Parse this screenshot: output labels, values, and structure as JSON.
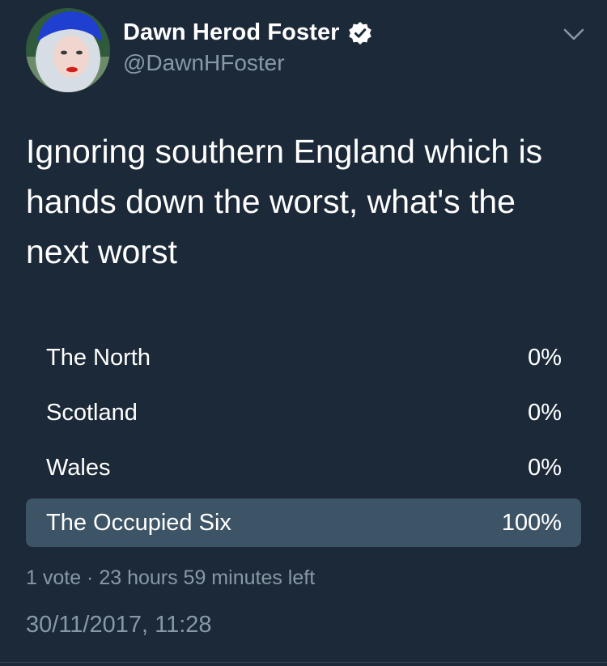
{
  "author": {
    "display_name": "Dawn Herod Foster",
    "handle": "@DawnHFoster",
    "verified": true,
    "avatar_icon": "profile-photo"
  },
  "tweet": {
    "text": "Ignoring southern England which is hands down the worst, what's the next worst"
  },
  "poll": {
    "options": [
      {
        "label": "The North",
        "percent_text": "0%",
        "percent": 0
      },
      {
        "label": "Scotland",
        "percent_text": "0%",
        "percent": 0
      },
      {
        "label": "Wales",
        "percent_text": "0%",
        "percent": 0
      },
      {
        "label": "The Occupied Six",
        "percent_text": "100%",
        "percent": 100
      }
    ],
    "meta": "1 vote · 23 hours 59 minutes left"
  },
  "timestamp": "30/11/2017, 11:28",
  "colors": {
    "background": "#1c2938",
    "secondary_text": "#8899a6",
    "poll_fill": "#3d5466"
  },
  "icons": {
    "verified": "verified-badge-icon",
    "menu": "chevron-down-icon"
  }
}
